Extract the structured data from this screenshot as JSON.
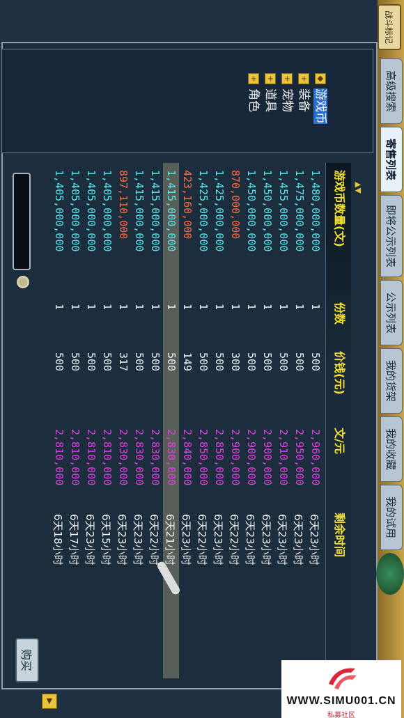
{
  "top": {
    "badge": "战斗标记"
  },
  "tabs": [
    {
      "label": "高级搜索"
    },
    {
      "label": "寄售列表"
    },
    {
      "label": "即将公示列表"
    },
    {
      "label": "公示列表"
    },
    {
      "label": "我的货架"
    },
    {
      "label": "我的收藏"
    },
    {
      "label": "我的试用"
    }
  ],
  "categories": [
    {
      "label": "游戏币",
      "selected": true
    },
    {
      "label": "装备"
    },
    {
      "label": "宠物"
    },
    {
      "label": "道具"
    },
    {
      "label": "角色"
    }
  ],
  "columns": {
    "amount": "游戏币数量(文)",
    "qty": "份数",
    "price": "价钱(元)",
    "rate": "文/元",
    "time": "剩余时间"
  },
  "rows": [
    {
      "amount": "1,480,000,000",
      "qty": "1",
      "price": "500",
      "rate": "2,960,000",
      "time": "6天23小时",
      "color": "cyan"
    },
    {
      "amount": "1,475,000,000",
      "qty": "1",
      "price": "500",
      "rate": "2,950,000",
      "time": "6天23小时",
      "color": "cyan"
    },
    {
      "amount": "1,455,000,000",
      "qty": "1",
      "price": "500",
      "rate": "2,910,000",
      "time": "6天23小时",
      "color": "cyan"
    },
    {
      "amount": "1,450,000,000",
      "qty": "1",
      "price": "500",
      "rate": "2,900,000",
      "time": "6天23小时",
      "color": "cyan"
    },
    {
      "amount": "1,450,000,000",
      "qty": "1",
      "price": "500",
      "rate": "2,900,000",
      "time": "6天23小时",
      "color": "cyan"
    },
    {
      "amount": "870,000,000",
      "qty": "1",
      "price": "300",
      "rate": "2,900,000",
      "time": "6天22小时",
      "color": "red"
    },
    {
      "amount": "1,425,000,000",
      "qty": "1",
      "price": "500",
      "rate": "2,850,000",
      "time": "6天23小时",
      "color": "cyan"
    },
    {
      "amount": "1,425,000,000",
      "qty": "1",
      "price": "500",
      "rate": "2,850,000",
      "time": "6天22小时",
      "color": "cyan"
    },
    {
      "amount": "423,160,000",
      "qty": "1",
      "price": "149",
      "rate": "2,840,000",
      "time": "6天23小时",
      "color": "red"
    },
    {
      "amount": "1,415,000,000",
      "qty": "1",
      "price": "500",
      "rate": "2,830,000",
      "time": "6天21小时",
      "color": "cyan",
      "highlight": true
    },
    {
      "amount": "1,415,000,000",
      "qty": "1",
      "price": "500",
      "rate": "2,830,000",
      "time": "6天22小时",
      "color": "cyan"
    },
    {
      "amount": "1,415,000,000",
      "qty": "1",
      "price": "500",
      "rate": "2,830,000",
      "time": "6天23小时",
      "color": "cyan"
    },
    {
      "amount": "897,110,000",
      "qty": "1",
      "price": "317",
      "rate": "2,830,000",
      "time": "6天23小时",
      "color": "red"
    },
    {
      "amount": "1,405,000,000",
      "qty": "1",
      "price": "500",
      "rate": "2,810,000",
      "time": "6天15小时",
      "color": "cyan"
    },
    {
      "amount": "1,405,000,000",
      "qty": "1",
      "price": "500",
      "rate": "2,810,000",
      "time": "6天23小时",
      "color": "cyan"
    },
    {
      "amount": "1,405,000,000",
      "qty": "1",
      "price": "500",
      "rate": "2,810,000",
      "time": "6天17小时",
      "color": "cyan"
    },
    {
      "amount": "1,405,000,000",
      "qty": "1",
      "price": "500",
      "rate": "2,810,000",
      "time": "6天18小时",
      "color": "cyan"
    }
  ],
  "buy_label": "购买",
  "watermark": {
    "text": "WWW.SIMU001.CN",
    "sub": "私募社区"
  },
  "colors": {
    "cyan_row": "#58e8ec",
    "red_row": "#ff6a3c",
    "rate": "#e040e0",
    "header": "#f2e030"
  }
}
